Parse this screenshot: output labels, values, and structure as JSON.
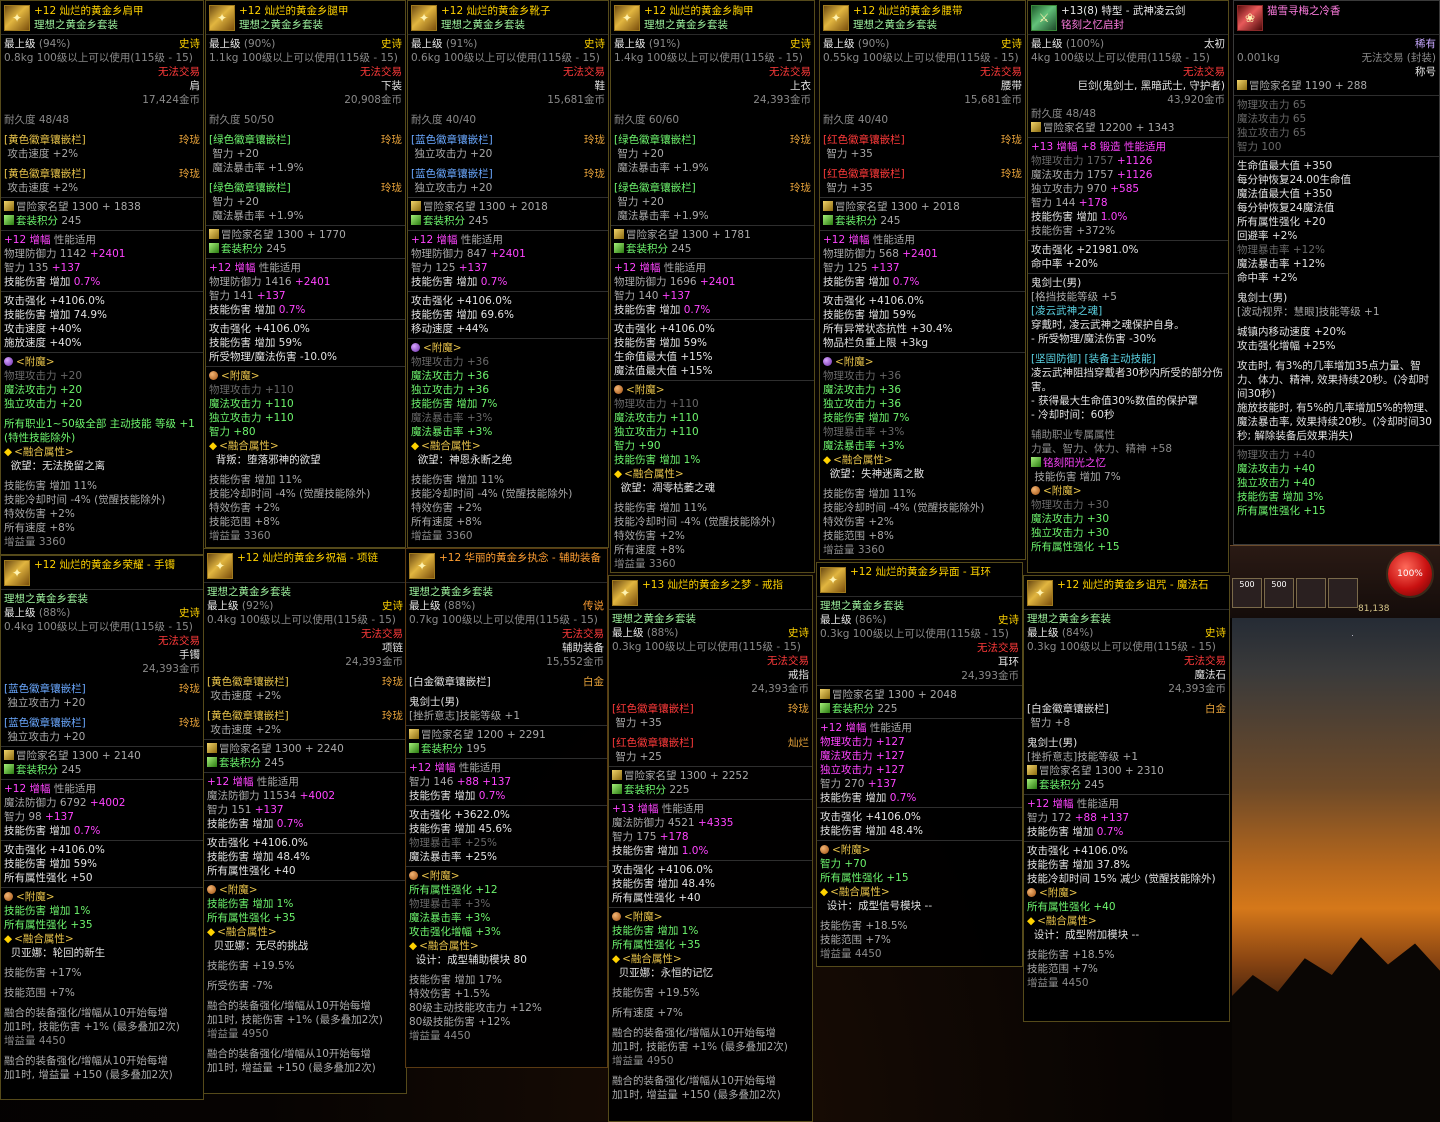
{
  "common": {
    "level": "最上级",
    "req": "100级以上可以使用(115级 - 15)",
    "no_trade": "无法交易",
    "set": "理想之黄金乡套装",
    "rep": "冒险家名望",
    "setpts": "套装积分",
    "dura": "耐久度",
    "skill_dmg_up": "技能伤害 增加",
    "atk_up": "攻击强化 +4106.0%",
    "atk_up2": "攻击强化 +3622.0%",
    "magic_atk": "魔法攻击力",
    "ind_atk": "独立攻击力",
    "phy_atk": "物理攻击力",
    "int": "智力",
    "all_str": "所有属性强化",
    "crit": "魔法暴击率",
    "enchant": "<附魔>",
    "fusion": "<融合属性>",
    "amp": "增幅",
    "perf": "性能适用",
    "skill_range": "技能范围",
    "skill_cd": "技能冷却时间 -4% (觉醒技能除外)",
    "special": "特效伤害",
    "all_spd": "所有速度",
    "fusion_text1": "融合的装备强化/增幅从10开始每增",
    "fusion_text2": "加1时, 技能伤害 +1% (最多叠加2次)",
    "fusion_text3": "加1时, 增益量 +150 (最多叠加2次)",
    "boost": "增益量"
  },
  "epic": "史诗",
  "legend": "传说",
  "taichu": "太初",
  "rare": "稀有",
  "p1": {
    "name": "+12 灿烂的黄金乡肩甲",
    "pct": "(94%)",
    "wt": "0.8kg",
    "type": "肩",
    "price": "17,424金币",
    "dura": "48/48",
    "s1": "[黄色徽章镶嵌栏]",
    "s1v": "攻击速度 +2%",
    "s1r": "玲珑",
    "s2": "[黄色徽章镶嵌栏]",
    "s2v": "攻击速度 +2%",
    "s2r": "玲珑",
    "rep": "1300 + 1838",
    "setpts": "245",
    "stat1": "物理防御力 1142",
    "stat1b": "+2401",
    "int": "智力 135",
    "intb": "+137",
    "dmg": "0.7%",
    "o1": "技能伤害 增加 74.9%",
    "o2": "攻击速度 +40%",
    "o3": "施放速度 +40%",
    "ench": "物理攻击力 +20",
    "ench2": "魔法攻击力 +20",
    "ench3": "独立攻击力 +20",
    "extra": "所有职业1~50级全部 主动技能 等级 +1 (特性技能除外)",
    "fuse": "欲望：无法挽留之离",
    "f1": "技能伤害 增加 11%",
    "f2": "特效伤害 +2%",
    "f3": "所有速度 +8%",
    "boost": "增益量 3360"
  },
  "p2": {
    "name": "+12 灿烂的黄金乡腿甲",
    "pct": "(90%)",
    "wt": "1.1kg",
    "type": "下装",
    "price": "20,908金币",
    "dura": "50/50",
    "s1": "[绿色徽章镶嵌栏]",
    "s1r": "玲珑",
    "s1a": "智力 +20",
    "s1b": "魔法暴击率 +1.9%",
    "s2": "[绿色徽章镶嵌栏]",
    "s2r": "玲珑",
    "s2a": "智力 +20",
    "s2b": "魔法暴击率 +1.9%",
    "rep": "1300 + 1770",
    "setpts": "245",
    "stat1": "物理防御力 1416",
    "stat1b": "+2401",
    "int": "智力 141",
    "intb": "+137",
    "dmg": "0.7%",
    "o1": "技能伤害 增加 59%",
    "o2": "所受物理/魔法伤害 -10.0%",
    "ench": "物理攻击力 +110",
    "ench2": "魔法攻击力 +110",
    "ench3": "独立攻击力 +110",
    "ench4": "智力 +80",
    "fuse": "背叛：堕落邪神的欲望",
    "f1": "技能伤害 增加 11%",
    "f2": "特效伤害 +2%",
    "f3": "技能范围 +8%",
    "boost": "增益量 3360"
  },
  "p3": {
    "name": "+12 灿烂的黄金乡靴子",
    "pct": "(91%)",
    "wt": "0.6kg",
    "type": "鞋",
    "price": "15,681金币",
    "dura": "40/40",
    "s1": "[蓝色徽章镶嵌栏]",
    "s1r": "玲珑",
    "s1a": "独立攻击力 +20",
    "s2": "[蓝色徽章镶嵌栏]",
    "s2r": "玲珑",
    "s2a": "独立攻击力 +20",
    "rep": "1300 + 2018",
    "setpts": "245",
    "stat1": "物理防御力 847",
    "stat1b": "+2401",
    "int": "智力 125",
    "intb": "+137",
    "dmg": "0.7%",
    "o1": "技能伤害 增加 69.6%",
    "o2": "移动速度 +44%",
    "ench": "物理攻击力 +36",
    "ench2": "魔法攻击力 +36",
    "ench3": "独立攻击力 +36",
    "ench4": "技能伤害 增加 7%",
    "ench5": "魔法暴击率 +3%",
    "ench6": "魔法暴击率 +3%",
    "fuse": "欲望：神恩永断之绝",
    "f1": "技能伤害 增加 11%",
    "f2": "特效伤害 +2%",
    "f3": "所有速度 +8%",
    "boost": "增益量 3360"
  },
  "p4": {
    "name": "+12 灿烂的黄金乡胸甲",
    "pct": "(91%)",
    "wt": "1.4kg",
    "type": "上衣",
    "price": "24,393金币",
    "dura": "60/60",
    "s1": "[绿色徽章镶嵌栏]",
    "s1r": "玲珑",
    "s1a": "智力 +20",
    "s1b": "魔法暴击率 +1.9%",
    "s2": "[绿色徽章镶嵌栏]",
    "s2r": "玲珑",
    "s2a": "智力 +20",
    "s2b": "魔法暴击率 +1.9%",
    "rep": "1300 + 1781",
    "setpts": "245",
    "stat1": "物理防御力 1696",
    "stat1b": "+2401",
    "int": "智力 140",
    "intb": "+137",
    "dmg": "0.7%",
    "o1": "技能伤害 增加 59%",
    "o2": "生命值最大值 +15%",
    "o3": "魔法值最大值 +15%",
    "ench": "物理攻击力 +110",
    "ench2": "魔法攻击力 +110",
    "ench3": "独立攻击力 +110",
    "ench4": "智力 +90",
    "ench5": "技能伤害 增加 1%",
    "fuse": "欲望：凋零枯萎之魂",
    "f1": "技能伤害 增加 11%",
    "f2": "特效伤害 +2%",
    "f3": "所有速度 +8%",
    "boost": "增益量 3360"
  },
  "p5": {
    "name": "+12 灿烂的黄金乡腰带",
    "pct": "(90%)",
    "wt": "0.55kg",
    "type": "腰带",
    "price": "15,681金币",
    "dura": "40/40",
    "s1": "[红色徽章镶嵌栏]",
    "s1r": "玲珑",
    "s1a": "智力 +35",
    "s2": "[红色徽章镶嵌栏]",
    "s2r": "玲珑",
    "s2a": "智力 +35",
    "rep": "1300 + 2018",
    "setpts": "245",
    "stat1": "物理防御力 568",
    "stat1b": "+2401",
    "int": "智力 125",
    "intb": "+137",
    "dmg": "0.7%",
    "o1": "技能伤害 增加 59%",
    "o2": "所有异常状态抗性 +30.4%",
    "o3": "物品栏负重上限 +3kg",
    "ench": "物理攻击力 +36",
    "ench2": "魔法攻击力 +36",
    "ench3": "独立攻击力 +36",
    "ench4": "技能伤害 增加 7%",
    "ench5": "物理暴击率 +3%",
    "ench6": "魔法暴击率 +3%",
    "fuse": "欲望：失神迷离之散",
    "f1": "技能伤害 增加 11%",
    "f2": "技能冷却时间 -4% (觉醒技能除外)",
    "f3": "特效伤害 +2%",
    "f4": "技能范围 +8%",
    "boost": "增益量 3360"
  },
  "p6": {
    "name": "+13(8) 特型 - 武神凌云剑",
    "sub": "铭刻之忆启封",
    "pct": "(100%)",
    "wt": "4kg",
    "type": "巨剑(鬼剑士, 黑暗武士, 守护者)",
    "price": "43,920金币",
    "dura": "48/48",
    "rep": "12200 + 1343",
    "amp": "+13 增幅 +8 锻造 性能适用",
    "phy": "物理攻击力 1757",
    "phyb": "+1126",
    "mag": "魔法攻击力 1757",
    "magb": "+1126",
    "ind": "独立攻击力 970",
    "indb": "+585",
    "int": "智力 144",
    "intb": "+178",
    "dmg": "1.0%",
    "dmg2": "技能伤害 +372%",
    "o1": "攻击强化 +21981.0%",
    "o2": "命中率 +20%",
    "job": "鬼剑士(男)",
    "job2": "[格挡技能等级 +5",
    "job3": "[凌云武神之魂]",
    "j1": "穿戴时, 凌云武神之魂保护自身。",
    "j2": "- 所受物理/魔法伤害 -30%",
    "j3": "[坚固防御] [装备主动技能]",
    "j4": "凌云武神阻挡穿戴者30秒内所受的部分伤害。",
    "j5": "- 获得最大生命值30%数值的保护罩",
    "j6": "- 冷却时间：60秒",
    "j7": "辅助职业专属属性",
    "j8": "力量、智力、体力、精神 +58",
    "insc": "铭刻阳光之忆",
    "insc1": "技能伤害 增加 7%",
    "ench": "物理攻击力 +30",
    "ench2": "魔法攻击力 +30",
    "ench3": "独立攻击力 +30",
    "ench4": "所有属性强化 +15"
  },
  "p7": {
    "name": "猫雪寻梅之冷香",
    "wt": "0.001kg",
    "type": "称号",
    "trade": "无法交易 (封装)",
    "rep": "1190 + 288",
    "s1": "物理攻击力 65",
    "s2": "魔法攻击力 65",
    "s3": "独立攻击力 65",
    "s4": "智力 100",
    "o1": "生命值最大值 +350",
    "o2": "每分钟恢复24.00生命值",
    "o3": "魔法值最大值 +350",
    "o4": "每分钟恢复24魔法值",
    "o5": "所有属性强化 +20",
    "o6": "回避率 +2%",
    "o7": "物理暴击率 +12%",
    "o8": "魔法暴击率 +12%",
    "o9": "命中率 +2%",
    "job": "鬼剑士(男)",
    "jb": "[波动视界：慧眼]技能等级 +1",
    "c1": "城镇内移动速度 +20%",
    "c2": "攻击强化增幅 +25%",
    "c3": "攻击时, 有3%的几率增加35点力量、智力、体力、精神, 效果持续20秒。(冷却时间30秒)",
    "c4": "施放技能时, 有5%的几率增加5%的物理、魔法暴击率, 效果持续20秒。(冷却时间30秒; 解除装备后效果消失)",
    "e1": "物理攻击力 +40",
    "e2": "魔法攻击力 +40",
    "e3": "独立攻击力 +40",
    "e4": "技能伤害 增加 3%",
    "e5": "所有属性强化 +15",
    "hud_pct": "100%",
    "hud_s1": "500",
    "hud_s2": "500",
    "coins": "81,138"
  },
  "q1": {
    "name": "+12 灿烂的黄金乡荣耀 - 手镯",
    "pct": "(88%)",
    "wt": "0.4kg",
    "type": "手镯",
    "price": "24,393金币",
    "s1": "[蓝色徽章镶嵌栏]",
    "s1r": "玲珑",
    "s1a": "独立攻击力 +20",
    "s2": "[蓝色徽章镶嵌栏]",
    "s2r": "玲珑",
    "s2a": "独立攻击力 +20",
    "rep": "1300 + 2140",
    "setpts": "245",
    "stat1": "魔法防御力 6792",
    "stat1b": "+4002",
    "int": "智力 98",
    "intb": "+137",
    "dmg": "0.7%",
    "o1": "技能伤害 增加 59%",
    "o2": "所有属性强化 +50",
    "ench": "技能伤害 增加 1%",
    "ench2": "所有属性强化 +35",
    "fuse": "贝亚娜：轮回的新生",
    "f1": "技能伤害 +17%",
    "f2": "技能范围 +7%",
    "boost": "增益量 4450"
  },
  "q2": {
    "name": "+12 灿烂的黄金乡祝福 - 项链",
    "pct": "(92%)",
    "wt": "0.4kg",
    "type": "项链",
    "price": "24,393金币",
    "s1": "[黄色徽章镶嵌栏]",
    "s1r": "玲珑",
    "s1a": "攻击速度 +2%",
    "s2": "[黄色徽章镶嵌栏]",
    "s2r": "玲珑",
    "s2a": "攻击速度 +2%",
    "rep": "1300 + 2240",
    "setpts": "245",
    "stat1": "魔法防御力 11534",
    "stat1b": "+4002",
    "int": "智力 151",
    "intb": "+137",
    "dmg": "0.7%",
    "o1": "技能伤害 增加 48.4%",
    "o2": "所有属性强化 +40",
    "ench": "技能伤害 增加 1%",
    "ench2": "所有属性强化 +35",
    "fuse": "贝亚娜：无尽的挑战",
    "f1": "技能伤害 +19.5%",
    "f2": "所受伤害 -7%",
    "boost": "增益量 4950"
  },
  "q3": {
    "name": "+12 华丽的黄金乡执念 - 辅助装备",
    "pct": "(88%)",
    "wt": "0.7kg",
    "type": "辅助装备",
    "price": "15,552金币",
    "s1": "[白金徽章镶嵌栏]",
    "s1r": "白金",
    "job": "鬼剑士(男)",
    "job2": "[挫折意志]技能等级 +1",
    "rep": "1200 + 2291",
    "setpts": "195",
    "int": "智力 146",
    "intb": "+88 +137",
    "dmg": "0.7%",
    "o1": "技能伤害 增加 45.6%",
    "o2": "物理暴击率 +25%",
    "o3": "魔法暴击率 +25%",
    "ench": "所有属性强化 +12",
    "ench2": "物理暴击率 +3%",
    "ench3": "魔法暴击率 +3%",
    "ench4": "攻击强化增幅 +3%",
    "fuse": "设计：成型辅助模块 80",
    "f1": "技能伤害 增加 17%",
    "f2": "特效伤害 +1.5%",
    "f3": "80级主动技能攻击力 +12%",
    "f4": "80级技能伤害 +12%",
    "boost": "增益量 4450"
  },
  "q4": {
    "name": "+13 灿烂的黄金乡之梦 - 戒指",
    "pct": "(88%)",
    "wt": "0.3kg",
    "type": "戒指",
    "price": "24,393金币",
    "s1": "[红色徽章镶嵌栏]",
    "s1r": "玲珑",
    "s1a": "智力 +35",
    "s2": "[红色徽章镶嵌栏]",
    "s2r": "灿烂",
    "s2a": "智力 +25",
    "rep": "1300 + 2252",
    "setpts": "225",
    "stat1": "魔法防御力 4521",
    "stat1b": "+4335",
    "int": "智力 175",
    "intb": "+178",
    "dmg": "1.0%",
    "o1": "技能伤害 增加 48.4%",
    "o2": "所有属性强化 +40",
    "ench": "技能伤害 增加 1%",
    "ench2": "所有属性强化 +35",
    "fuse": "贝亚娜：永恒的记忆",
    "f1": "技能伤害 +19.5%",
    "f2": "所有速度 +7%",
    "boost": "增益量 4950"
  },
  "q5": {
    "name": "+12 灿烂的黄金乡异面 - 耳环",
    "pct": "(86%)",
    "wt": "0.3kg",
    "type": "耳环",
    "price": "24,393金币",
    "rep": "1300 + 2048",
    "setpts": "225",
    "a1": "物理攻击力 +127",
    "a2": "魔法攻击力 +127",
    "a3": "独立攻击力 +127",
    "int": "智力 270",
    "intb": "+137",
    "dmg": "0.7%",
    "o1": "技能伤害 增加 48.4%",
    "ench": "智力 +70",
    "ench2": "所有属性强化 +15",
    "fuse": "设计：成型信号模块 --",
    "f1": "技能伤害 +18.5%",
    "f2": "技能范围 +7%",
    "boost": "增益量 4450"
  },
  "q6": {
    "name": "+12 灿烂的黄金乡诅咒 - 魔法石",
    "pct": "(84%)",
    "wt": "0.3kg",
    "type": "魔法石",
    "price": "24,393金币",
    "s1": "[白金徽章镶嵌栏]",
    "s1r": "白金",
    "s1a": "智力 +8",
    "job": "鬼剑士(男)",
    "job2": "[挫折意志]技能等级 +1",
    "rep": "1300 + 2310",
    "setpts": "245",
    "int": "智力 172",
    "intb": "+88 +137",
    "dmg": "0.7%",
    "o1": "技能伤害 增加 37.8%",
    "o2": "技能冷却时间 15% 减少 (觉醒技能除外)",
    "ench": "所有属性强化 +40",
    "fuse": "设计：成型附加模块 --",
    "f1": "技能伤害 +18.5%",
    "f2": "技能范围 +7%",
    "boost": "增益量 4450"
  },
  "colors": {
    "epic": "#ffd200",
    "legend": "#ff9f33",
    "red": "#ff3a3a",
    "magenta": "#ff44ff",
    "green": "#6df46d"
  },
  "icons": {
    "item": "gold-armor-icon",
    "weapon": "sword-icon",
    "title": "title-badge-icon",
    "enchant": "orb-icon",
    "fusion": "diamond-icon"
  }
}
